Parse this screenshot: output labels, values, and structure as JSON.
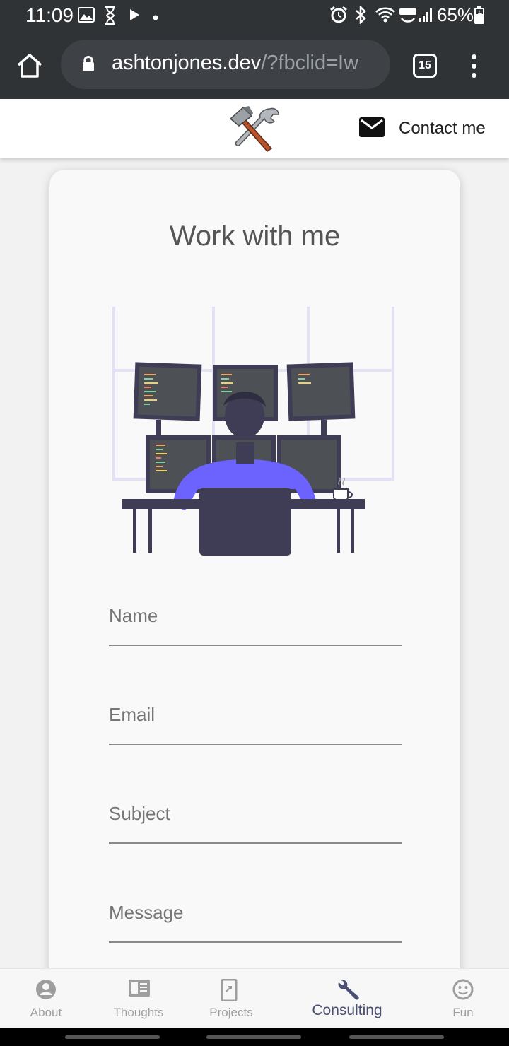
{
  "status_bar": {
    "time": "11:09",
    "battery": "65%"
  },
  "browser": {
    "url_host": "ashtonjones.dev",
    "url_path": "/?fbclid=Iw",
    "tab_count": "15"
  },
  "header": {
    "contact_label": "Contact me"
  },
  "main": {
    "title": "Work with me",
    "form": {
      "name_label": "Name",
      "email_label": "Email",
      "subject_label": "Subject",
      "message_label": "Message"
    }
  },
  "nav": {
    "items": [
      {
        "label": "About",
        "icon": "account-circle-icon"
      },
      {
        "label": "Thoughts",
        "icon": "article-icon"
      },
      {
        "label": "Projects",
        "icon": "projects-icon"
      },
      {
        "label": "Consulting",
        "icon": "wrench-icon",
        "active": true
      },
      {
        "label": "Fun",
        "icon": "smiley-icon"
      }
    ],
    "active_color": "#4a4f72",
    "inactive_color": "#9e9e9e"
  }
}
